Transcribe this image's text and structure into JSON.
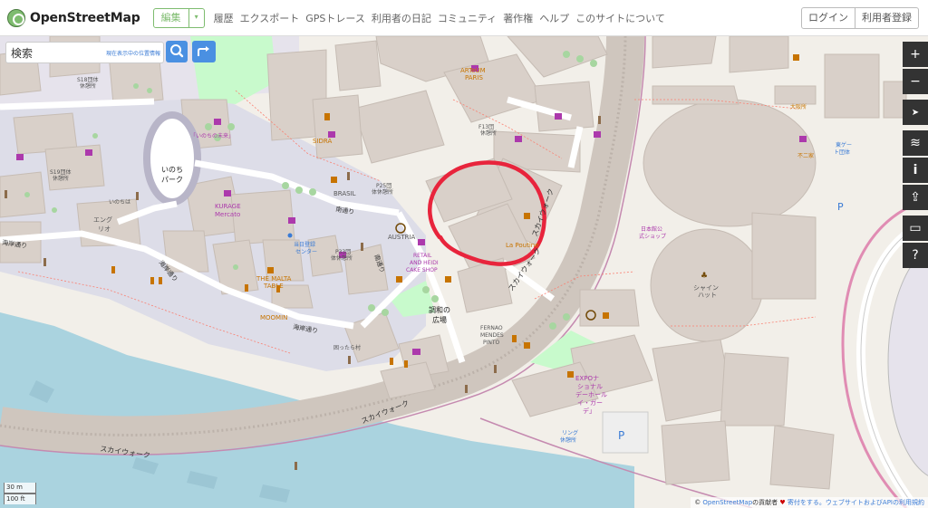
{
  "header": {
    "brand": "OpenStreetMap",
    "edit_label": "編集",
    "edit_caret": "▾",
    "nav": [
      "履歴",
      "エクスポート",
      "GPSトレース",
      "利用者の日記",
      "コミュニティ",
      "著作権",
      "ヘルプ",
      "このサイトについて"
    ],
    "login_label": "ログイン",
    "signup_label": "利用者登録"
  },
  "search": {
    "value": "検索",
    "where_label": "現在表示中の位置情報"
  },
  "map_labels": {
    "inochi_park": "いのち\nパーク",
    "inochi_park_l1": "いのち",
    "inochi_park_l2": "パーク",
    "kaigan1": "海岸通り",
    "kaigan2": "海岸通り",
    "kaigan3": "海岸通り",
    "minami1": "南通り",
    "minami2": "南通り",
    "sidra": "SIDRA",
    "kurage_l1": "KURAGE",
    "kurage_l2": "Mercato",
    "malta_l1": "THE MALTA",
    "malta_l2": "TABLE",
    "moomin": "MOOMIN",
    "austria": "AUSTRIA",
    "retail_l1": "RETAIL",
    "retail_l2": "AND HEIDI",
    "retail_l3": "CAKE SHOP",
    "brasil": "BRASIL",
    "p25_l1": "P25団",
    "p25_l2": "体休憩所",
    "p33_l1": "P33団",
    "p33_l2": "体休憩所",
    "f13_l1": "F13団",
    "f13_l2": "休憩所",
    "s19_l1": "S19団体",
    "s19_l2": "休憩所",
    "s18_l1": "S18団体",
    "s18_l2": "休憩所",
    "arteum_l1": "ARTeUM",
    "arteum_l2": "PARIS",
    "la_poutine": "La Poutine",
    "skywalk1": "スカイウォーク",
    "skywalk2": "スカイウォーク",
    "skywalk3": "スカイウォーク",
    "chowa_l1": "調和の",
    "chowa_l2": "広場",
    "fernao_l1": "FERNAO",
    "fernao_l2": "MENDES",
    "fernao_l3": "PINTO",
    "expo_l1": "EXPOナ",
    "expo_l2": "ショナル",
    "expo_l3": "デーホール",
    "expo_l4": "イ・ガー",
    "expo_l5": "デ」",
    "shine_l1": "シャイン",
    "shine_l2": "ハット",
    "engiri_l1": "エング",
    "engiri_l2": "リオ",
    "inochi_mirai": "「いのちの未来」",
    "tojitsu_l1": "当日登録",
    "tojitsu_l2": "センター",
    "komatta": "困ったら村",
    "ring_l1": "リング",
    "ring_l2": "休憩所",
    "higashi_l1": "東ゲー",
    "higashi_l2": "ト団体",
    "fujiko": "不二家",
    "ohokawa": "大阪所",
    "nihon_l1": "日本館公",
    "nihon_l2": "式ショップ",
    "inochi_wa": "いのちは"
  },
  "controls": {
    "zoom_in": "+",
    "zoom_out": "−",
    "locate": "➤",
    "layers": "≋",
    "info": "i",
    "share": "⇪",
    "note": "▭",
    "query": "?"
  },
  "scale": {
    "metric": "30 m",
    "imperial": "100 ft"
  },
  "attribution": {
    "prefix": "© ",
    "osm_link": "OpenStreetMap",
    "contributors": "の貢献者 ",
    "heart": "♥",
    "donate": " 寄付をする",
    "rest": "。ウェブサイトおよびAPIの利用規約"
  },
  "colors": {
    "land": "#f2efe9",
    "building": "#d9d0c9",
    "water": "#aad3df",
    "pedestrian": "#dddde8",
    "park": "#c8facc",
    "annotation": "#e8243c",
    "accent_green": "#7ebc6f",
    "button_blue": "#4a90e2"
  }
}
